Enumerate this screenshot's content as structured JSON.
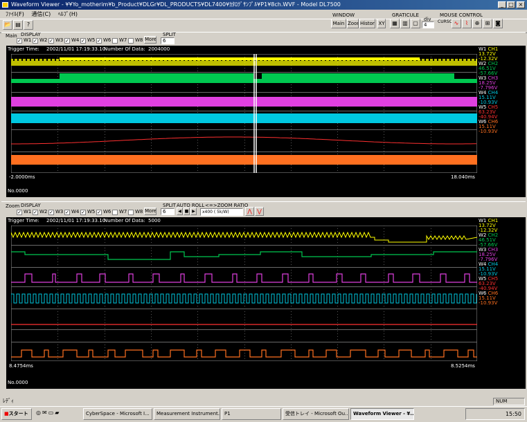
{
  "window": {
    "title": "Waveform Viewer - ¥¥Yo_motherim¥b_Product¥DLGr¥DL_PRODUCTS¥DL7400¥ｶﾀﾛｸﾞｻﾝﾌﾟﾙ¥P1¥8ch.WVF - Model DL7500",
    "icon": "waveform-app-icon"
  },
  "menu": [
    "ﾌｧｲﾙ(F)",
    "通信(C)",
    "ﾍﾙﾌﾟ(H)"
  ],
  "toolbar": {
    "icons": [
      "open-folder-icon",
      "print-icon",
      "help-icon"
    ],
    "window_group": {
      "label": "WINDOW",
      "buttons": [
        "Main",
        "Zoom",
        "History",
        "XY"
      ]
    },
    "graticule_group": {
      "label": "GRATICULE",
      "div_label": "div",
      "div_value": "4"
    },
    "mouse_group": {
      "label": "MOUSE CONTROL",
      "cursor_label": "CURSOR"
    }
  },
  "main_panel": {
    "label": "Main",
    "display_label": "DISPLAY",
    "waves": [
      "W1",
      "W2",
      "W3",
      "W4",
      "W5",
      "W6",
      "W7",
      "W8"
    ],
    "checked": [
      true,
      true,
      true,
      true,
      true,
      true,
      false,
      false
    ],
    "more": "More",
    "split_label": "SPLIT",
    "split_value": "6",
    "trigger_label": "Trigger Time:",
    "trigger_time": "2002/11/01   17:19:33.10",
    "nod_label": "Number Of Data:",
    "nod_value": "2004000",
    "x_start": "-2.0000ms",
    "x_end": "18.040ms",
    "record_no": "No.0000"
  },
  "zoom_panel": {
    "label": "Zoom",
    "display_label": "DISPLAY",
    "waves": [
      "W1",
      "W2",
      "W3",
      "W4",
      "W5",
      "W6",
      "W7",
      "W8"
    ],
    "checked": [
      true,
      true,
      true,
      true,
      true,
      true,
      false,
      false
    ],
    "more": "More",
    "split_label": "SPLIT",
    "split_value": "6",
    "autoroll_label": "AUTO ROLL",
    "zoomratio_label": "<=>ZOOM RATIO",
    "zoomratio_value": "x400 ( 5k/W)",
    "trigger_label": "Trigger Time:",
    "trigger_time": "2002/11/01   17:19:33.10",
    "nod_label": "Number Of Data:",
    "nod_value": "5000",
    "x_start": "8.4754ms",
    "x_end": "8.5254ms",
    "record_no": "No.0000"
  },
  "channels": [
    {
      "w": "W1",
      "ch": "CH1",
      "top": "13.72V",
      "bottom": "-12.32V",
      "color": "#ffff00"
    },
    {
      "w": "W2",
      "ch": "CH2",
      "top": "46.51V",
      "bottom": "-57.66V",
      "color": "#00c850"
    },
    {
      "w": "W3",
      "ch": "CH3",
      "top": "18.25V",
      "bottom": "-7.796V",
      "color": "#e040e0"
    },
    {
      "w": "W4",
      "ch": "CH4",
      "top": "15.11V",
      "bottom": "-10.93V",
      "color": "#00c8e0"
    },
    {
      "w": "W5",
      "ch": "CH5",
      "top": "63.23V",
      "bottom": "-40.94V",
      "color": "#ff3030"
    },
    {
      "w": "W6",
      "ch": "CH6",
      "top": "15.11V",
      "bottom": "-10.93V",
      "color": "#ff7020"
    }
  ],
  "status": {
    "left": "ﾚﾃﾞｨ",
    "num": "NUM"
  },
  "taskbar": {
    "start": "スタート",
    "tasks": [
      "CyberSpace - Microsoft I...",
      "Measurement Instrument...",
      "P1",
      "受信トレイ - Microsoft Ou...",
      "Waveform Viewer - ¥..."
    ],
    "clock": "15:50"
  }
}
